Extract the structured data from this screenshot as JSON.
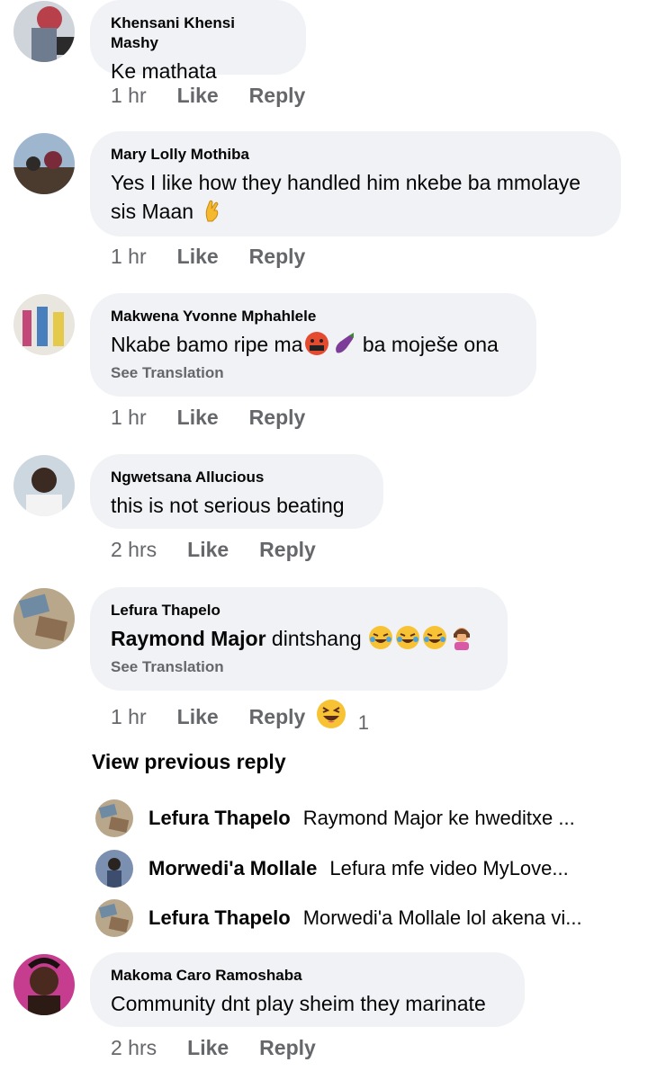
{
  "comments": [
    {
      "name": "Khensani Khensi Mashy",
      "text": "Ke mathata",
      "time": "1 hr"
    },
    {
      "name": "Mary Lolly Mothiba",
      "text_line1": "Yes I like how they handled him nkebe ba mmolaye",
      "text_line2": "sis Maan",
      "time": "1 hr"
    },
    {
      "name": "Makwena Yvonne Mphahlele",
      "text_pre": "Nkabe bamo ripe ma",
      "text_post": " ba moješe ona",
      "see_translation": "See Translation",
      "time": "1 hr"
    },
    {
      "name": "Ngwetsana Allucious",
      "text": "this is not serious beating",
      "time": "2 hrs"
    },
    {
      "name": "Lefura Thapelo",
      "mention": "Raymond Major",
      "text": " dintshang",
      "see_translation": "See Translation",
      "time": "1 hr",
      "reaction_count": "1"
    },
    {
      "name": "Makoma Caro Ramoshaba",
      "text": "Community dnt play sheim they marinate",
      "time": "2 hrs"
    }
  ],
  "actions": {
    "like": "Like",
    "reply": "Reply"
  },
  "view_previous": "View previous reply",
  "replies": [
    {
      "name": "Lefura Thapelo",
      "text": "Raymond Major ke hweditxe ..."
    },
    {
      "name": "Morwedi'a Mollale",
      "text": "Lefura mfe video MyLove..."
    },
    {
      "name": "Lefura Thapelo",
      "text": "Morwedi'a Mollale lol akena vi..."
    }
  ],
  "colors": {
    "bubble": "#f0f2f5",
    "meta": "#65676b",
    "text": "#050505"
  }
}
